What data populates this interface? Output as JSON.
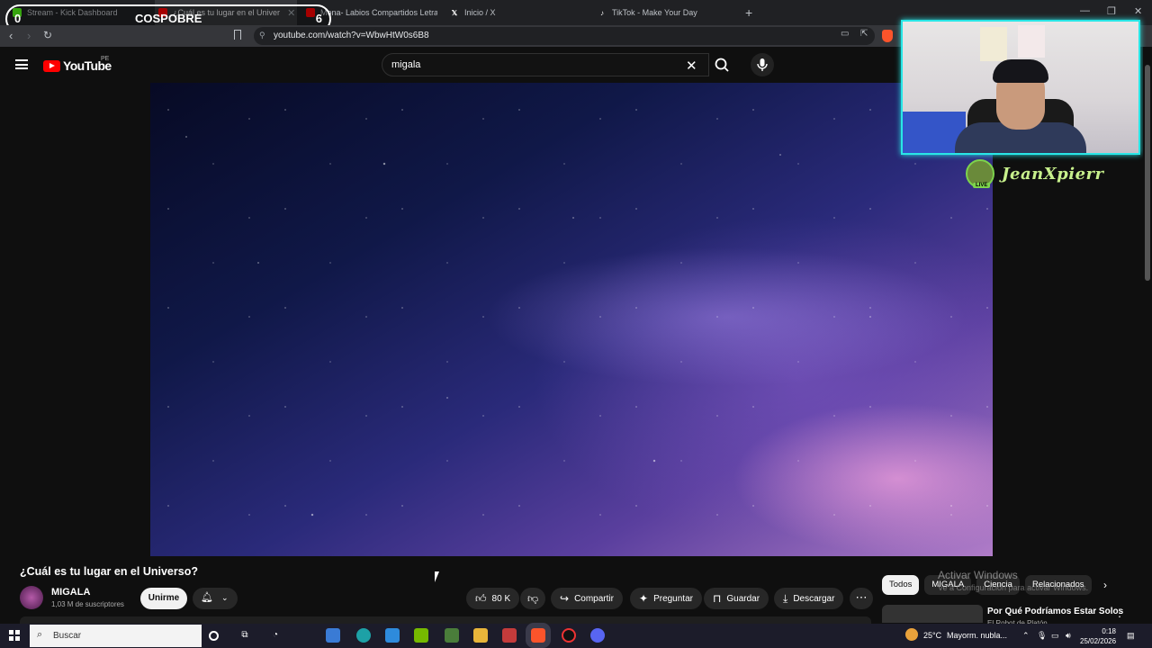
{
  "browser": {
    "tabs": [
      {
        "label": "Stream - Kick Dashboard",
        "icon": "kick-icon"
      },
      {
        "label": "¿Cuál es tu lugar en el Univer",
        "icon": "youtube-icon",
        "active": true
      },
      {
        "label": "Mona- Labios Compartidos Letra - Yo",
        "icon": "youtube-icon"
      },
      {
        "label": "Inicio / X",
        "icon": "x-icon"
      },
      {
        "label": "TikTok - Make Your Day",
        "icon": "tiktok-icon"
      }
    ],
    "url": "youtube.com/watch?v=WbwHtW0s6B8"
  },
  "overlay": {
    "score_left": "0",
    "score_right": "6",
    "team_label": "COSPOBRE",
    "streamer_name": "JeanXpierr",
    "live_badge": "LIVE"
  },
  "youtube": {
    "logo_text": "YouTube",
    "country_code": "PE",
    "search_value": "migala",
    "video_title": "¿Cuál es tu lugar en el Universo?",
    "channel_name": "MIGALA",
    "subscribers": "1,03 M de suscriptores",
    "join_label": "Unirme",
    "likes": "80 K",
    "share_label": "Compartir",
    "ask_label": "Preguntar",
    "save_label": "Guardar",
    "download_label": "Descargar",
    "chips": [
      "Todos",
      "MIGALA",
      "Ciencia",
      "Relacionados"
    ],
    "related_title": "Por Qué Podríamos Estar Solos",
    "related_channel": "El Robot de Platón"
  },
  "windows_watermark": {
    "title": "Activar Windows",
    "subtitle": "Ve a Configuración para activar Windows."
  },
  "taskbar": {
    "search_placeholder": "Buscar",
    "temperature": "25°C",
    "weather": "Mayorm. nubla...",
    "time": "0:18",
    "date": "25/02/2026"
  }
}
